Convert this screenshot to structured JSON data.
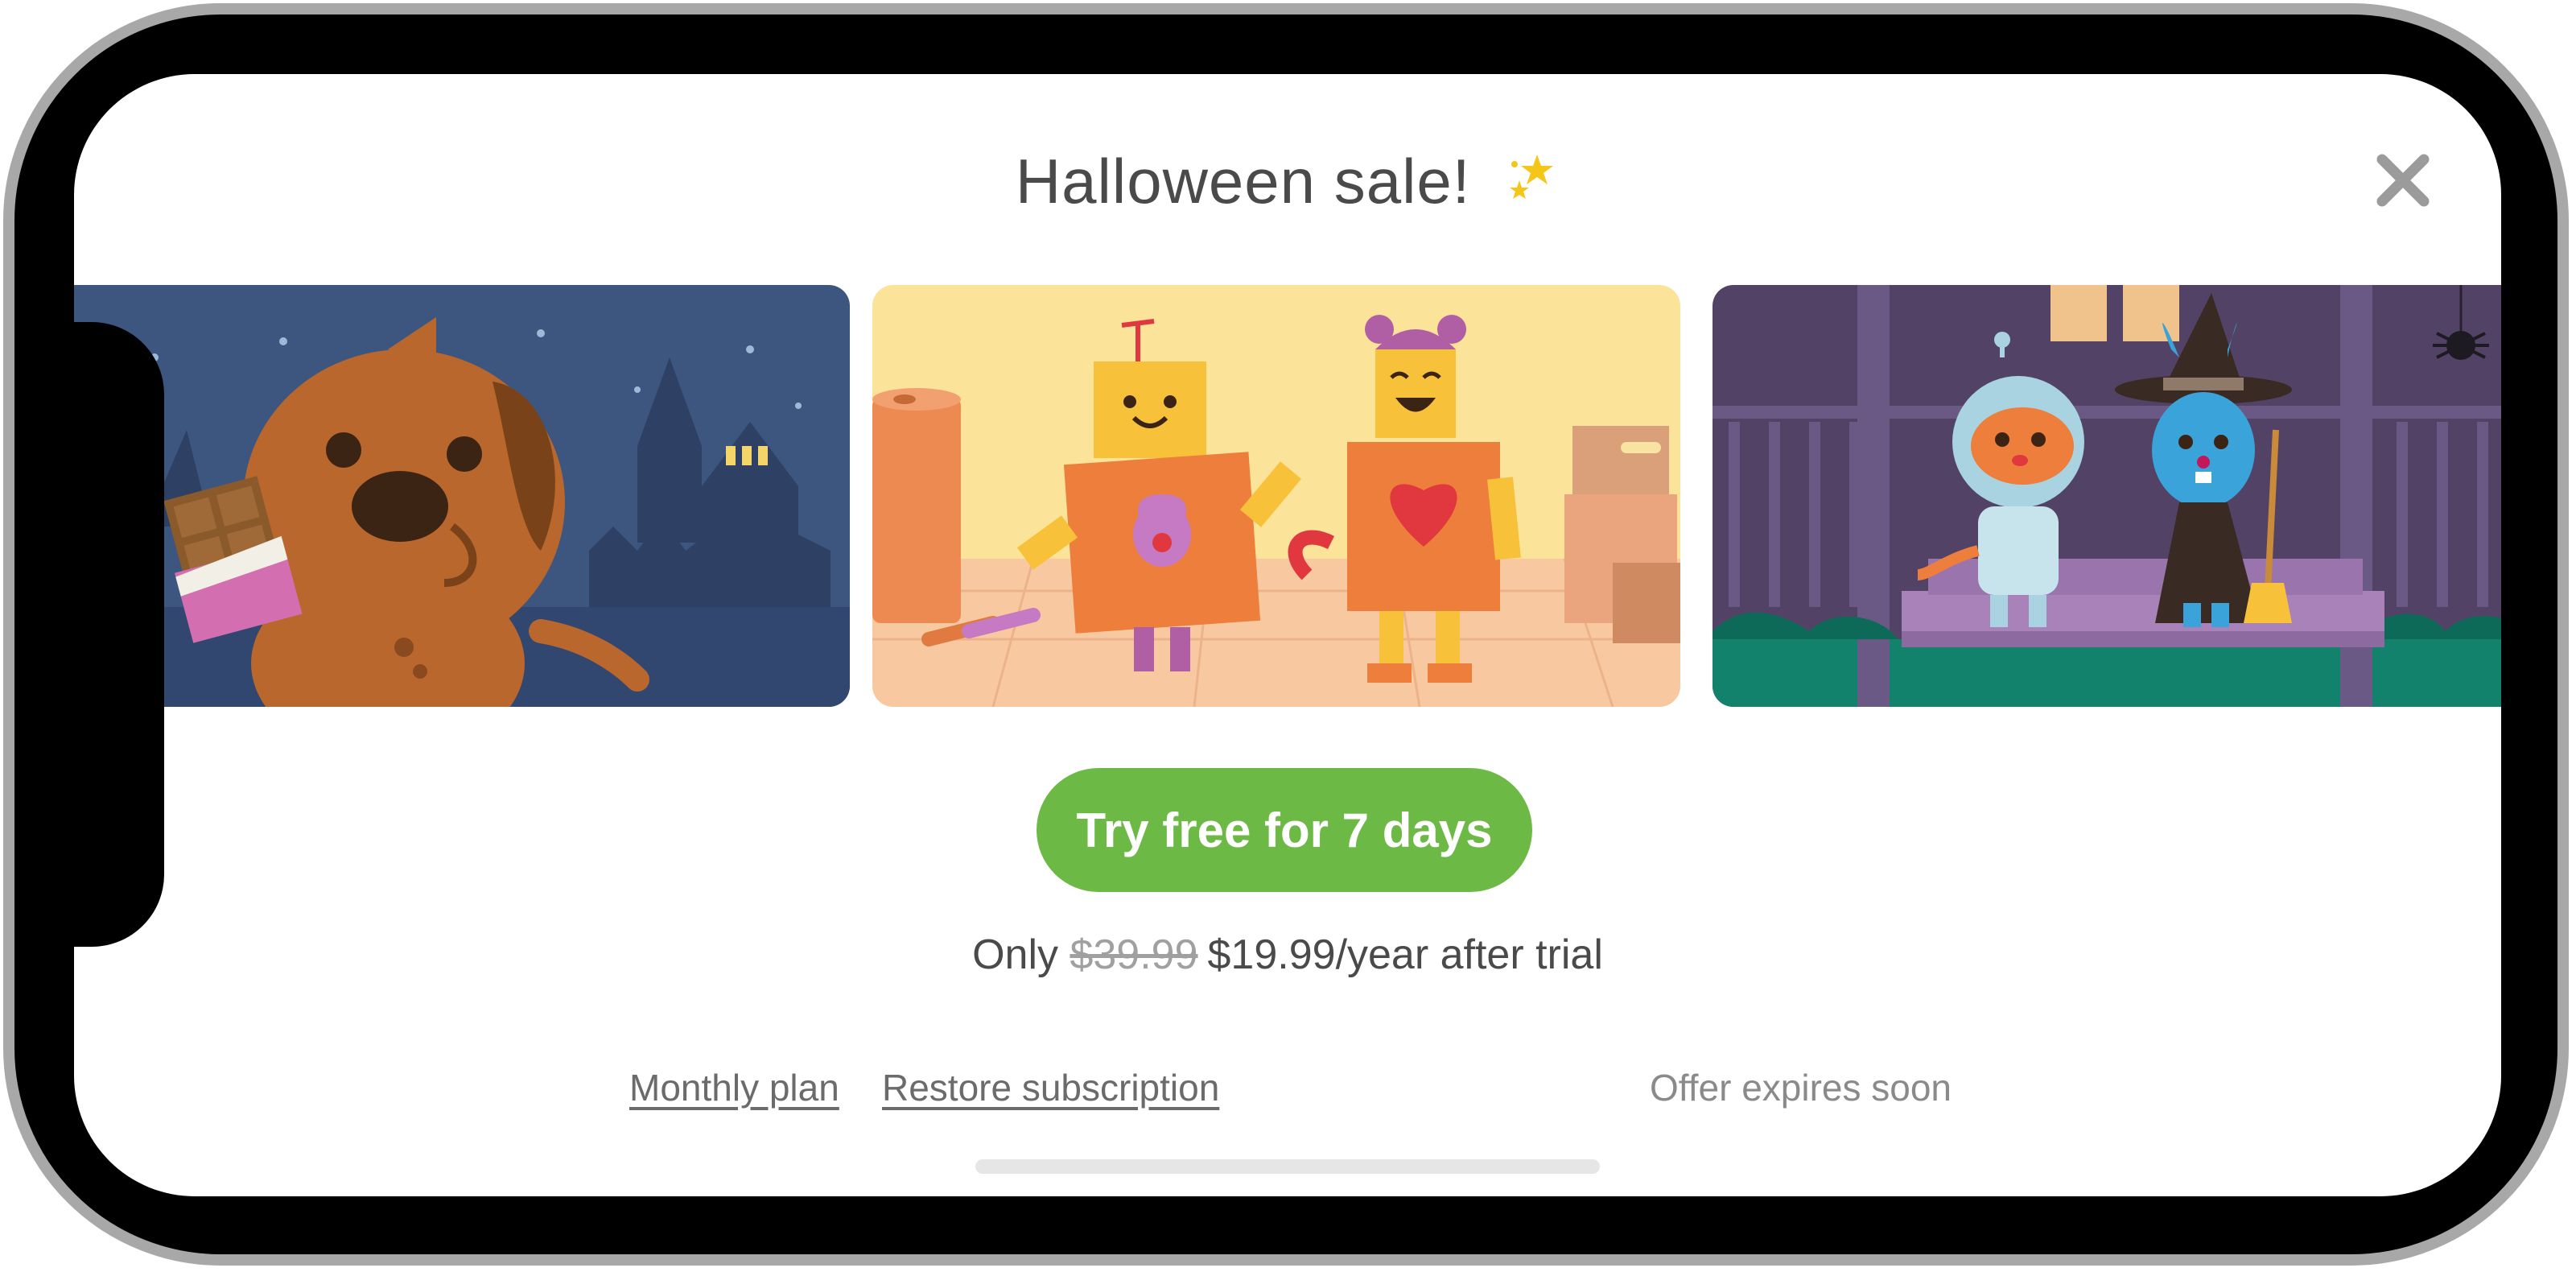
{
  "header": {
    "title": "Halloween sale!",
    "title_icon": "sparkle-stars-icon",
    "close_icon": "close-icon"
  },
  "carousel": {
    "slides": [
      {
        "name": "dog-with-chocolate-illustration",
        "bg": "#3d5680"
      },
      {
        "name": "robot-costume-friends-illustration",
        "bg": "#fbe49a"
      },
      {
        "name": "astronaut-and-witch-illustration",
        "bg": "#514266"
      }
    ]
  },
  "cta": {
    "label": "Try free for 7 days",
    "color": "#6cba45"
  },
  "pricing": {
    "prefix": "Only",
    "old_price": "$39.99",
    "new_price": "$19.99/year after trial"
  },
  "footer": {
    "monthly_plan": "Monthly plan",
    "restore": "Restore subscription",
    "expires": "Offer expires soon"
  }
}
